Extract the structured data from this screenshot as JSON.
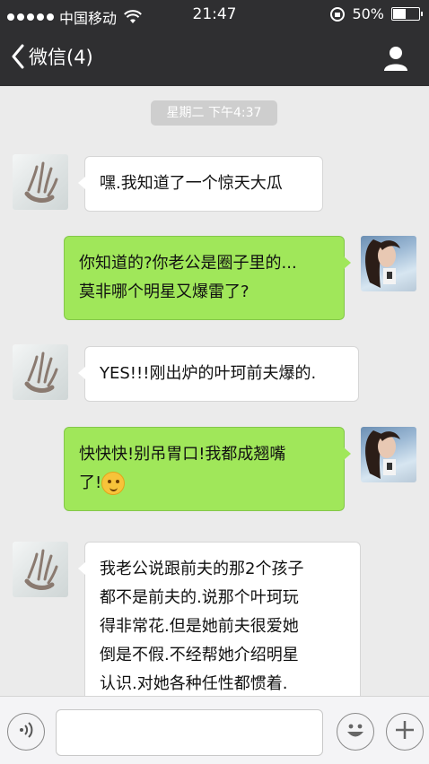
{
  "status_bar": {
    "carrier": "中国移动",
    "time": "21:47",
    "battery": "50%",
    "battery_level": 0.5
  },
  "nav": {
    "back_label": "微信(4)",
    "back_icon": "chevron-left-icon",
    "contact_icon": "person-icon"
  },
  "chat": {
    "timestamp": "星期二 下午4:37",
    "messages": [
      {
        "side": "in",
        "text": "嘿.我知道了一个惊天大瓜"
      },
      {
        "side": "out",
        "text": "你知道的?你老公是圈子里的...\n莫非哪个明星又爆雷了?"
      },
      {
        "side": "in",
        "text": "YES!!!刚出炉的叶珂前夫爆的."
      },
      {
        "side": "out",
        "text": "快快快!别吊胃口!我都成翘嘴\n了!",
        "emoji": "thinking-face-icon"
      },
      {
        "side": "in",
        "text": "我老公说跟前夫的那2个孩子\n都不是前夫的.说那个叶珂玩\n得非常花.但是她前夫很爱她\n倒是不假.不经帮她介绍明星\n认识.对她各种任性都惯着."
      }
    ]
  },
  "input_bar": {
    "voice_icon": "voice-icon",
    "emoji_icon": "emoji-icon",
    "plus_icon": "plus-icon",
    "input_value": ""
  },
  "colors": {
    "bar_bg": "#2f2f31",
    "chat_bg": "#ebebeb",
    "bubble_out": "#a0e75a",
    "bubble_in": "#ffffff"
  }
}
